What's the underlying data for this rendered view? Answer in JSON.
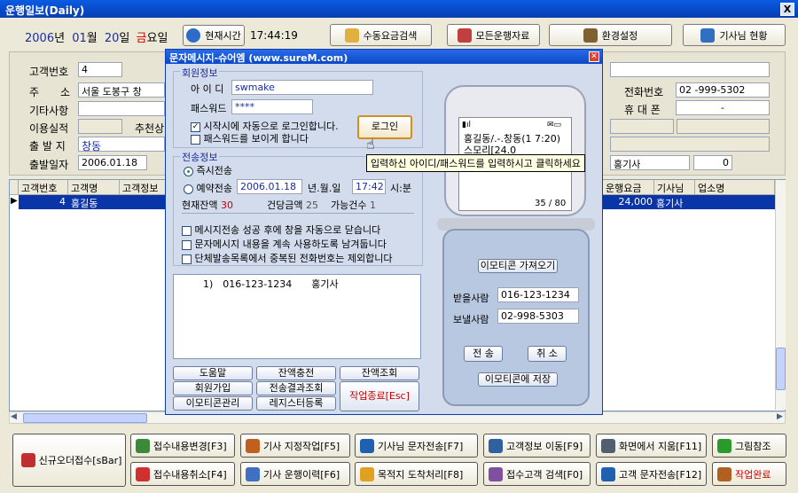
{
  "window": {
    "title": "운행일보(Daily)",
    "close": "X"
  },
  "datebar": {
    "year": "2006",
    "nyeon": "년",
    "month": "01",
    "wol": "월",
    "day": "20",
    "il": "일",
    "weekday": "금",
    "yoil": "요일",
    "now_label": "현재시간",
    "time": "17:44:19"
  },
  "toolbar": {
    "manual_search": "수동요금검색",
    "all_data": "모든운행자료",
    "settings": "환경설정",
    "driver_status": "기사님 현황"
  },
  "form": {
    "customer_no_label": "고객번호",
    "customer_no": "4",
    "address_label": "주　　소",
    "address": "서울 도봉구 창",
    "misc_label": "기타사항",
    "history_label": "이용실적",
    "recommend_label": "추천상",
    "origin_label": "출 발 지",
    "origin": "창동",
    "depart_date_label": "출발일자",
    "depart_date": "2006.01.18",
    "phone_label": "전화번호",
    "phone": "02 -999-5302",
    "mobile_label": "휴 대 폰",
    "mobile": "-",
    "driver": "홍기사",
    "zero": "0"
  },
  "grid": {
    "headers": [
      "고객번호",
      "고객명",
      "고객정보"
    ],
    "right_headers": [
      "운행요금",
      "기사님",
      "업소명"
    ],
    "row": {
      "no": "4",
      "name": "홍길동",
      "fare": "24,000",
      "driver": "홍기사"
    }
  },
  "dialog": {
    "title": "문자메시지-슈어엠 (www.sureM.com)",
    "member_section": "회원정보",
    "id_label": "아 이 디",
    "id_value": "swmake",
    "pw_label": "패스워드",
    "pw_value": "****",
    "auto_login": "시작시에 자동으로 로그인합니다.",
    "show_pw": "패스워드를 보이게 합니다",
    "login_btn": "로그인",
    "tooltip": "입력하신 아이디/패스워드를 입력하시고 클릭하세요",
    "send_section": "전송정보",
    "instant": "즉시전송",
    "reserve": "예약전송",
    "reserve_date": "2006.01.18",
    "ymd": "년.월.일",
    "reserve_time": "17:42",
    "hm": "시:분",
    "balance_label": "현재잔액",
    "balance": "30",
    "unit_label": "건당금액",
    "unit": "25",
    "count_label": "가능건수",
    "count": "1",
    "opt1": "메시지전송 성공 후에 창을 자동으로 닫습니다",
    "opt2": "문자메시지 내용을 계속 사용하도록 남겨둡니다",
    "opt3": "단체발송목록에서 중복된 전화번호는 제외합니다",
    "list_item": "1)　016-123-1234　　홍기사",
    "btn_help": "도움말",
    "btn_charge": "잔액충전",
    "btn_balance": "잔액조회",
    "btn_join": "회원가입",
    "btn_result": "전송결과조회",
    "btn_quit": "작업종료[Esc]",
    "btn_emoticon": "이모티콘관리",
    "btn_registry": "레지스터등록",
    "phone_msg": "홍길동/.-.창동(1 7:20)스모리[24.0",
    "phone_counter": "35 / 80",
    "emoticon_get": "이모티콘 가져오기",
    "recv_label": "받을사람",
    "recv": "016-123-1234",
    "send_label": "보낼사람",
    "send": "02-998-5303",
    "send_btn": "전 송",
    "cancel_btn": "취 소",
    "emoticon_save": "이모티콘에 저장"
  },
  "bottom": {
    "new_order": "신규오더접수[sBar]",
    "b1": "접수내용변경[F3]",
    "b2": "기사 지정작업[F5]",
    "b3": "기사님 문자전송[F7]",
    "b4": "고객정보 이동[F9]",
    "b5": "화면에서 지움[F11]",
    "b6": "그림참조",
    "c1": "접수내용취소[F4]",
    "c2": "기사 운행이력[F6]",
    "c3": "목적지 도착처리[F8]",
    "c4": "접수고객 검색[F0]",
    "c5": "고객 문자전송[F12]",
    "c6": "작업완료"
  }
}
